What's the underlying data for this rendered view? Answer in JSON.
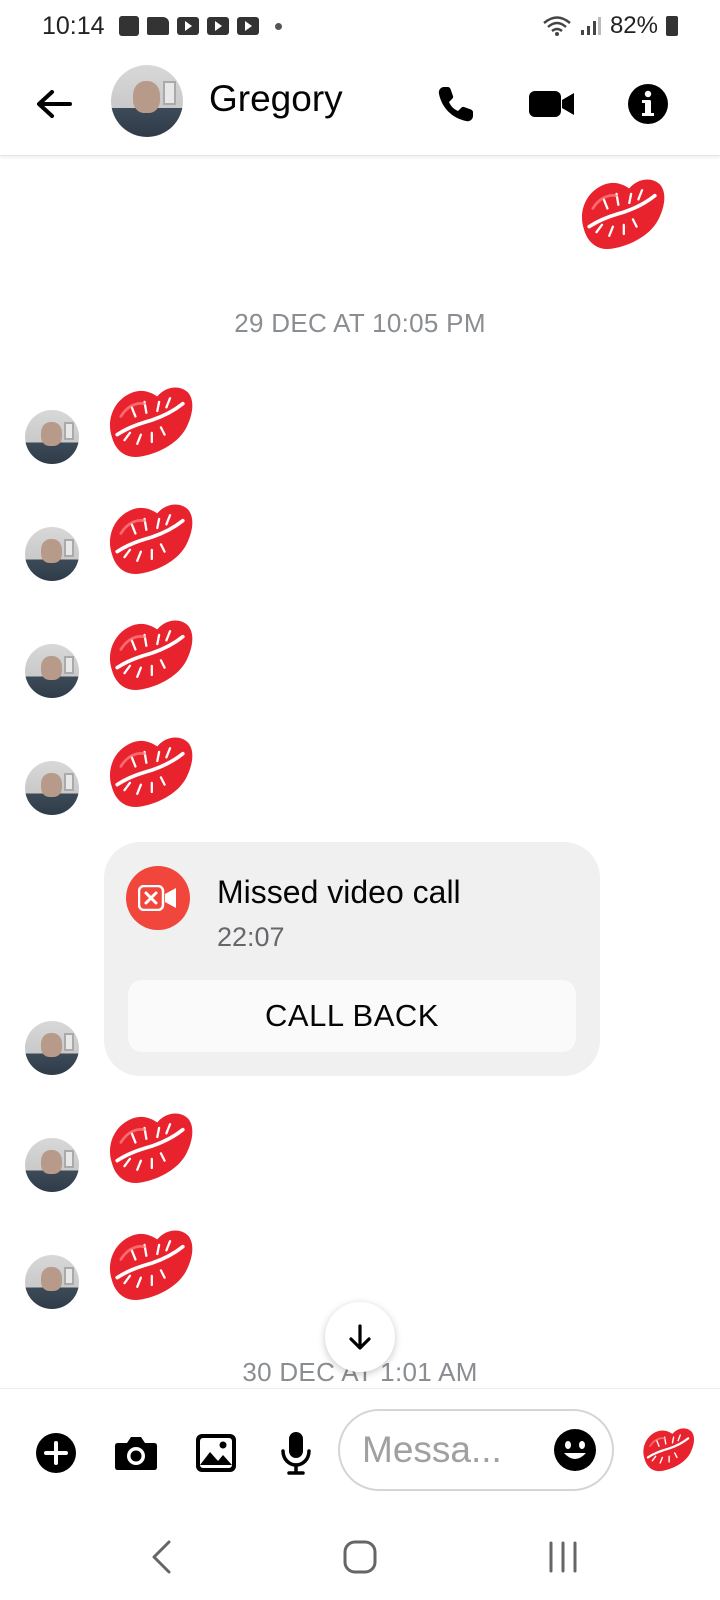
{
  "status_bar": {
    "time": "10:14",
    "battery": "82%",
    "icons": [
      "store-icon",
      "folder-icon",
      "youtube-icon",
      "youtube-icon",
      "youtube-icon",
      "dot-icon",
      "wifi-icon",
      "signal-icon",
      "battery-icon"
    ]
  },
  "header": {
    "contact_name": "Gregory",
    "back_icon": "arrow-left-icon",
    "actions": [
      "phone-icon",
      "video-camera-icon",
      "info-icon"
    ]
  },
  "conversation": {
    "timestamps": [
      "29 DEC AT 10:05 PM",
      "30 DEC AT 1:01 AM"
    ],
    "messages": [
      {
        "sender": "me",
        "content": "kiss-mark-emoji"
      },
      {
        "sender": "Gregory",
        "content": "kiss-mark-emoji"
      },
      {
        "sender": "Gregory",
        "content": "kiss-mark-emoji"
      },
      {
        "sender": "Gregory",
        "content": "kiss-mark-emoji"
      },
      {
        "sender": "Gregory",
        "content": "kiss-mark-emoji"
      },
      {
        "sender": "Gregory",
        "content": "missed-call-card"
      },
      {
        "sender": "Gregory",
        "content": "kiss-mark-emoji"
      },
      {
        "sender": "Gregory",
        "content": "kiss-mark-emoji"
      }
    ],
    "missed_call": {
      "title": "Missed video call",
      "time": "22:07",
      "button_label": "CALL BACK"
    }
  },
  "composer": {
    "placeholder": "Messa...",
    "buttons": [
      "plus-icon",
      "camera-icon",
      "gallery-icon",
      "microphone-icon",
      "emoji-icon",
      "kiss-mark-icon"
    ]
  },
  "nav_bar": {
    "buttons": [
      "back-nav-icon",
      "home-nav-icon",
      "recents-nav-icon"
    ]
  },
  "colors": {
    "kiss_red": "#e8232e",
    "missed_call_red": "#f0463b",
    "timestamp_gray": "#8a8d91",
    "card_bg": "#f0f0f0"
  }
}
